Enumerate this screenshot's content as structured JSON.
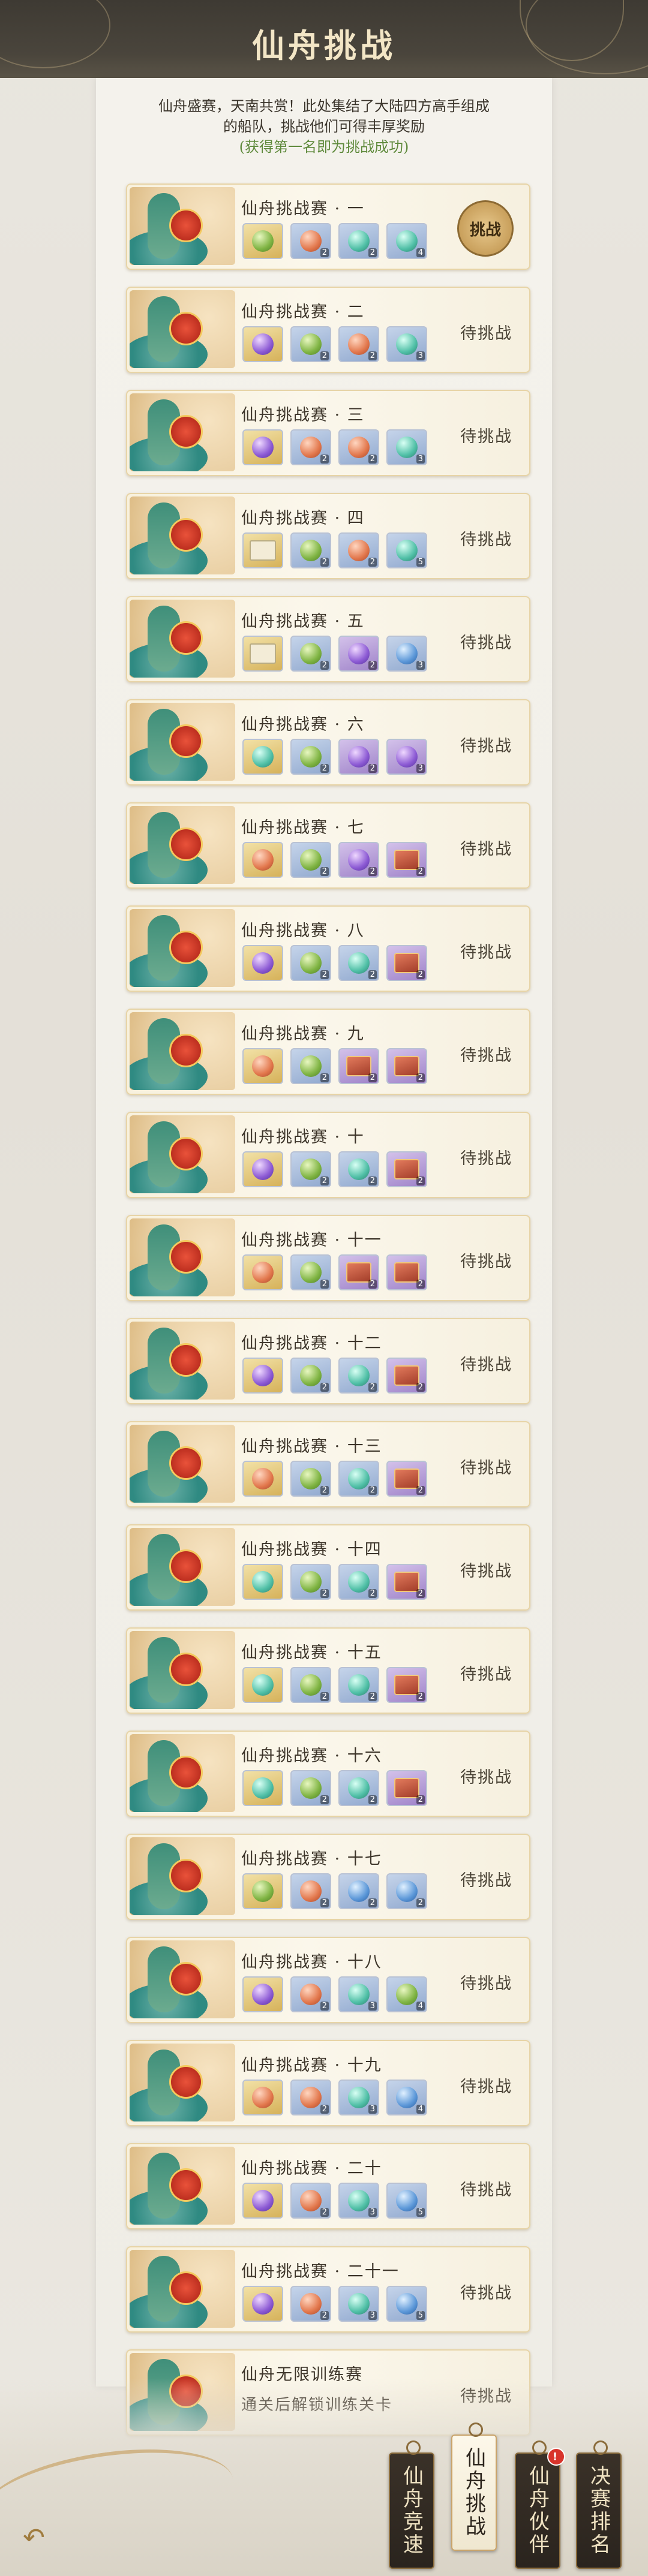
{
  "header": {
    "title": "仙舟挑战"
  },
  "intro": {
    "line1": "仙舟盛赛，天南共赏！此处集结了大陆四方高手组成",
    "line2": "的船队，挑战他们可得丰厚奖励",
    "hint": "(获得第一名即为挑战成功)"
  },
  "challenges": [
    {
      "name": "仙舟挑战赛 · 一",
      "status": "挑战",
      "rewards": [
        [
          "orb-green",
          ""
        ],
        [
          "orb-red",
          "2"
        ],
        [
          "orb-teal",
          "2"
        ],
        [
          "orb-teal",
          "4"
        ]
      ]
    },
    {
      "name": "仙舟挑战赛 · 二",
      "status": "待挑战",
      "rewards": [
        [
          "orb-purple",
          ""
        ],
        [
          "orb-green",
          "2"
        ],
        [
          "orb-red",
          "2"
        ],
        [
          "orb-teal",
          "3"
        ]
      ]
    },
    {
      "name": "仙舟挑战赛 · 三",
      "status": "待挑战",
      "rewards": [
        [
          "orb-purple",
          ""
        ],
        [
          "orb-red",
          "2"
        ],
        [
          "orb-red",
          "2"
        ],
        [
          "orb-teal",
          "3"
        ]
      ]
    },
    {
      "name": "仙舟挑战赛 · 四",
      "status": "待挑战",
      "rewards": [
        [
          "scroll",
          ""
        ],
        [
          "orb-green",
          "2"
        ],
        [
          "orb-red",
          "2"
        ],
        [
          "orb-teal",
          "5"
        ]
      ]
    },
    {
      "name": "仙舟挑战赛 · 五",
      "status": "待挑战",
      "rewards": [
        [
          "scroll",
          ""
        ],
        [
          "orb-green",
          "2"
        ],
        [
          "orb-purple",
          "2"
        ],
        [
          "orb-blue",
          "3"
        ]
      ]
    },
    {
      "name": "仙舟挑战赛 · 六",
      "status": "待挑战",
      "rewards": [
        [
          "orb-teal",
          ""
        ],
        [
          "orb-green",
          "2"
        ],
        [
          "orb-purple",
          "2"
        ],
        [
          "orb-purple",
          "3"
        ]
      ]
    },
    {
      "name": "仙舟挑战赛 · 七",
      "status": "待挑战",
      "rewards": [
        [
          "orb-red",
          ""
        ],
        [
          "orb-green",
          "2"
        ],
        [
          "orb-purple",
          "2"
        ],
        [
          "box",
          "2"
        ]
      ]
    },
    {
      "name": "仙舟挑战赛 · 八",
      "status": "待挑战",
      "rewards": [
        [
          "orb-purple",
          ""
        ],
        [
          "orb-green",
          "2"
        ],
        [
          "orb-teal",
          "2"
        ],
        [
          "box",
          "2"
        ]
      ]
    },
    {
      "name": "仙舟挑战赛 · 九",
      "status": "待挑战",
      "rewards": [
        [
          "orb-red",
          ""
        ],
        [
          "orb-green",
          "2"
        ],
        [
          "box",
          "2"
        ],
        [
          "box",
          "2"
        ]
      ]
    },
    {
      "name": "仙舟挑战赛 · 十",
      "status": "待挑战",
      "rewards": [
        [
          "orb-purple",
          ""
        ],
        [
          "orb-green",
          "2"
        ],
        [
          "orb-teal",
          "2"
        ],
        [
          "box",
          "2"
        ]
      ]
    },
    {
      "name": "仙舟挑战赛 · 十一",
      "status": "待挑战",
      "rewards": [
        [
          "orb-red",
          ""
        ],
        [
          "orb-green",
          "2"
        ],
        [
          "box",
          "2"
        ],
        [
          "box",
          "2"
        ]
      ]
    },
    {
      "name": "仙舟挑战赛 · 十二",
      "status": "待挑战",
      "rewards": [
        [
          "orb-purple",
          ""
        ],
        [
          "orb-green",
          "2"
        ],
        [
          "orb-teal",
          "2"
        ],
        [
          "box",
          "2"
        ]
      ]
    },
    {
      "name": "仙舟挑战赛 · 十三",
      "status": "待挑战",
      "rewards": [
        [
          "orb-red",
          ""
        ],
        [
          "orb-green",
          "2"
        ],
        [
          "orb-teal",
          "2"
        ],
        [
          "box",
          "2"
        ]
      ]
    },
    {
      "name": "仙舟挑战赛 · 十四",
      "status": "待挑战",
      "rewards": [
        [
          "orb-teal",
          ""
        ],
        [
          "orb-green",
          "2"
        ],
        [
          "orb-teal",
          "2"
        ],
        [
          "box",
          "2"
        ]
      ]
    },
    {
      "name": "仙舟挑战赛 · 十五",
      "status": "待挑战",
      "rewards": [
        [
          "orb-teal",
          ""
        ],
        [
          "orb-green",
          "2"
        ],
        [
          "orb-teal",
          "2"
        ],
        [
          "box",
          "2"
        ]
      ]
    },
    {
      "name": "仙舟挑战赛 · 十六",
      "status": "待挑战",
      "rewards": [
        [
          "orb-teal",
          ""
        ],
        [
          "orb-green",
          "2"
        ],
        [
          "orb-teal",
          "2"
        ],
        [
          "box",
          "2"
        ]
      ]
    },
    {
      "name": "仙舟挑战赛 · 十七",
      "status": "待挑战",
      "rewards": [
        [
          "orb-green",
          ""
        ],
        [
          "orb-red",
          "2"
        ],
        [
          "orb-blue",
          "2"
        ],
        [
          "orb-blue",
          "2"
        ]
      ]
    },
    {
      "name": "仙舟挑战赛 · 十八",
      "status": "待挑战",
      "rewards": [
        [
          "orb-purple",
          ""
        ],
        [
          "orb-red",
          "2"
        ],
        [
          "orb-teal",
          "3"
        ],
        [
          "orb-green",
          "4"
        ]
      ]
    },
    {
      "name": "仙舟挑战赛 · 十九",
      "status": "待挑战",
      "rewards": [
        [
          "orb-red",
          ""
        ],
        [
          "orb-red",
          "2"
        ],
        [
          "orb-teal",
          "3"
        ],
        [
          "orb-blue",
          "4"
        ]
      ]
    },
    {
      "name": "仙舟挑战赛 · 二十",
      "status": "待挑战",
      "rewards": [
        [
          "orb-purple",
          ""
        ],
        [
          "orb-red",
          "2"
        ],
        [
          "orb-teal",
          "3"
        ],
        [
          "orb-blue",
          "5"
        ]
      ]
    },
    {
      "name": "仙舟挑战赛 · 二十一",
      "status": "待挑战",
      "rewards": [
        [
          "orb-purple",
          ""
        ],
        [
          "orb-red",
          "2"
        ],
        [
          "orb-teal",
          "3"
        ],
        [
          "orb-blue",
          "5"
        ]
      ]
    },
    {
      "name": "仙舟无限训练赛",
      "status": "待挑战",
      "subtext": "通关后解锁训练关卡",
      "rewards": []
    }
  ],
  "tabs": [
    {
      "label": "仙舟竞速",
      "active": false,
      "badge": ""
    },
    {
      "label": "仙舟挑战",
      "active": true,
      "badge": ""
    },
    {
      "label": "仙舟伙伴",
      "active": false,
      "badge": "!"
    },
    {
      "label": "决赛排名",
      "active": false,
      "badge": ""
    }
  ],
  "icons": {
    "back": "back-arrow-icon"
  }
}
